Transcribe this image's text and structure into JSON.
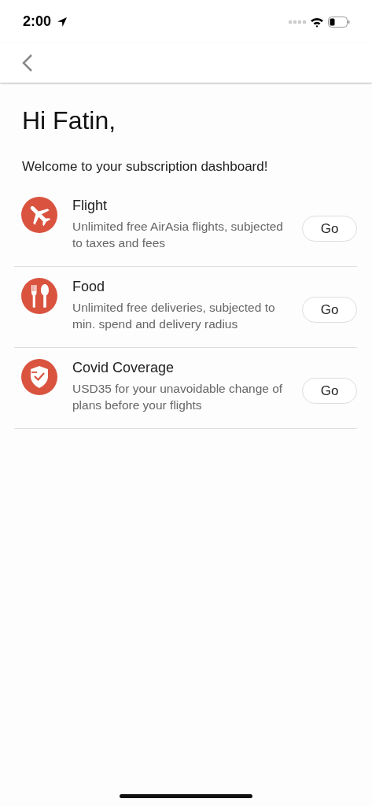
{
  "status_bar": {
    "time": "2:00"
  },
  "greeting": "Hi Fatin,",
  "welcome": "Welcome to your subscription dashboard!",
  "services": [
    {
      "kind": "flight",
      "title": "Flight",
      "description": "Unlimited free AirAsia flights, subjected to taxes and fees",
      "button": "Go"
    },
    {
      "kind": "food",
      "title": "Food",
      "description": "Unlimited free deliveries, subjected to min. spend and delivery radius",
      "button": "Go"
    },
    {
      "kind": "shield",
      "title": "Covid Coverage",
      "description": "USD35 for your unavoidable change of plans before your flights",
      "button": "Go"
    }
  ]
}
